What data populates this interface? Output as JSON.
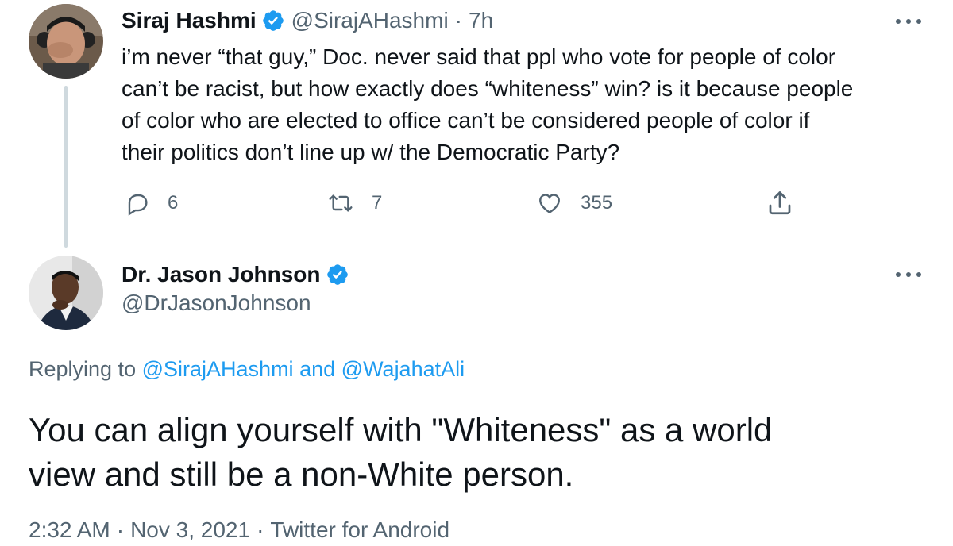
{
  "original_tweet": {
    "author_name": "Siraj Hashmi",
    "handle": "@SirajAHashmi",
    "separator": "·",
    "time": "7h",
    "text_lines": [
      "i’m never “that guy,” Doc. never said that ppl who vote for people of color",
      "can’t be racist, but how exactly does “whiteness” win? is it because people",
      "of color who are elected to office can’t be considered people of color if",
      "their politics don’t line up w/ the Democratic Party?"
    ],
    "actions": {
      "replies": "6",
      "retweets": "7",
      "likes": "355"
    }
  },
  "reply_tweet": {
    "author_name": "Dr. Jason Johnson",
    "handle": "@DrJasonJohnson",
    "replying_to_prefix": "Replying to",
    "replying_to_user1": "@SirajAHashmi",
    "replying_to_and": "and",
    "replying_to_user2": "@WajahatAli",
    "text_lines": [
      "You can align yourself with \"Whiteness\" as a world",
      "view and still be a non-White person."
    ],
    "meta": {
      "time": "2:32 AM",
      "date": "Nov 3, 2021",
      "source": "Twitter for Android",
      "separator": "·"
    }
  },
  "colors": {
    "text_primary": "#0f1419",
    "text_secondary": "#536471",
    "link": "#1d9bf0",
    "verified": "#1d9bf0",
    "thread_line": "#cfd9de"
  },
  "icons": {
    "verified": "verified-badge-icon",
    "more": "more-options-icon",
    "reply": "reply-icon",
    "retweet": "retweet-icon",
    "like": "heart-icon",
    "share": "share-icon"
  }
}
